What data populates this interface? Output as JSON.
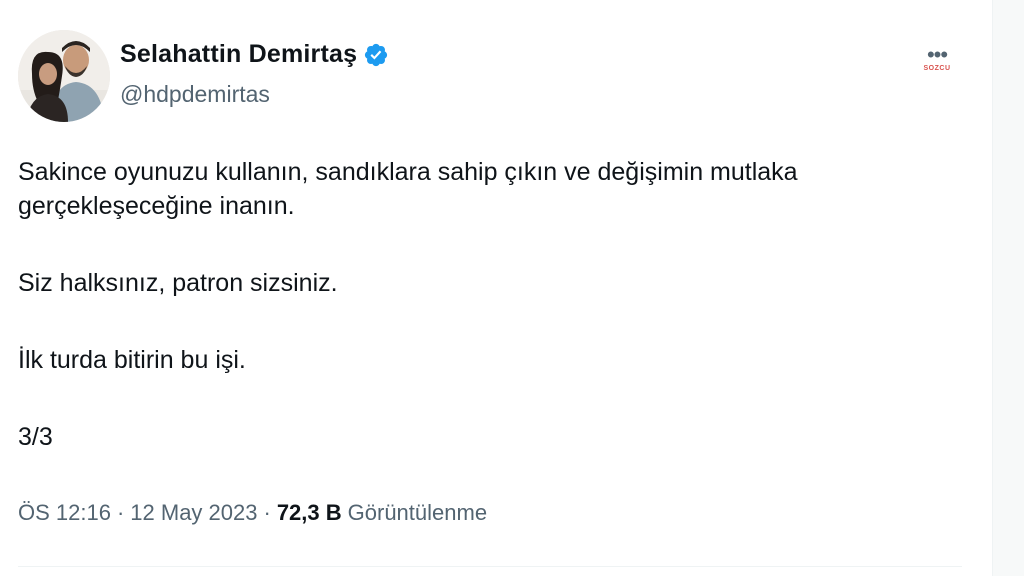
{
  "author": {
    "display_name": "Selahattin Demirtaş",
    "handle": "@hdpdemirtas",
    "verified": true
  },
  "tweet": {
    "paragraph1_line1": "Sakince oyunuzu kullanın, sandıklara sahip çıkın ve değişimin mutlaka",
    "paragraph1_line2": "gerçekleşeceğine inanın.",
    "paragraph2": "Siz halksınız, patron sizsiniz.",
    "paragraph3": "İlk turda bitirin bu işi.",
    "paragraph4": "3/3"
  },
  "meta": {
    "time": "ÖS 12:16",
    "separator": "·",
    "date": "12 May 2023",
    "views_count": "72,3 B",
    "views_label": "Görüntülenme"
  },
  "icons": {
    "verified": "verified-badge-icon",
    "more": "more-options-icon"
  },
  "colors": {
    "verified_blue": "#1d9bf0",
    "text_primary": "#0f1419",
    "text_secondary": "#536471"
  }
}
